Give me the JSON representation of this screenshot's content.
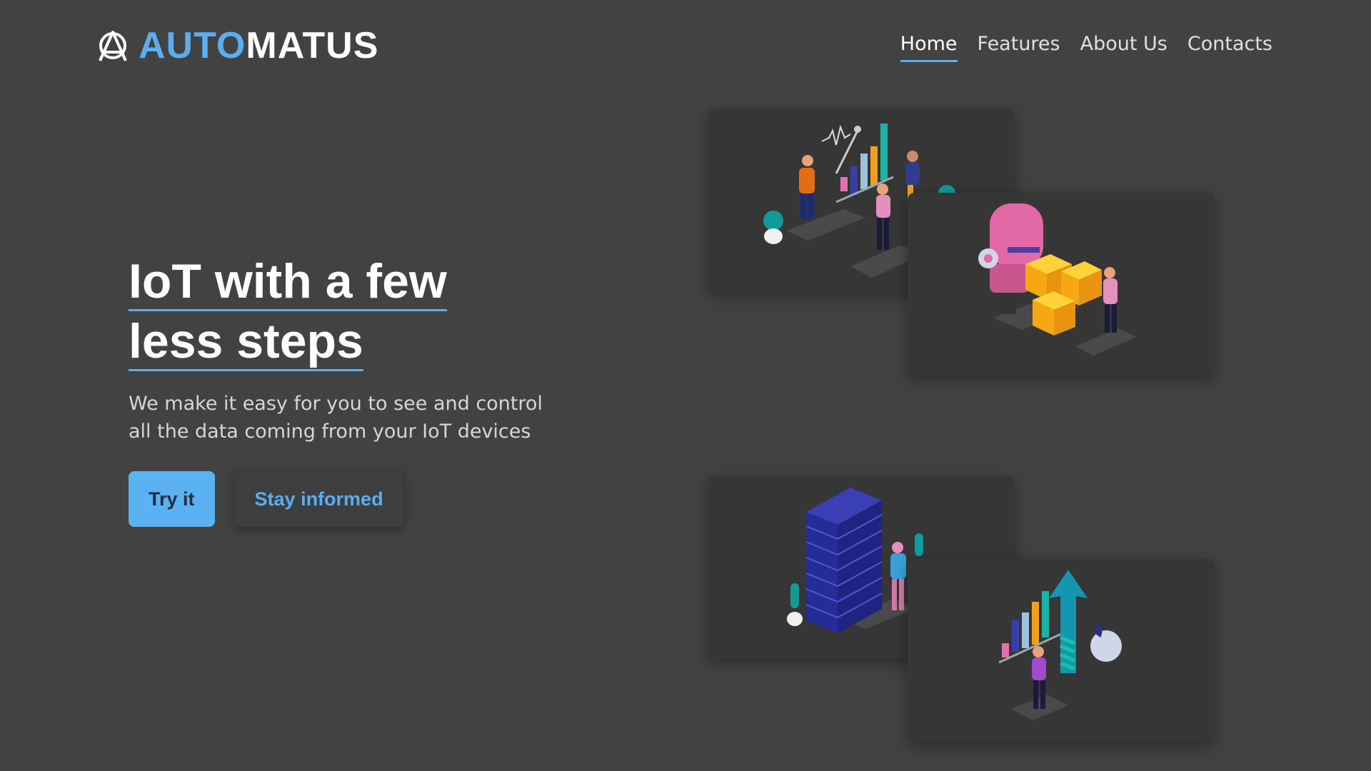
{
  "brand": {
    "name_accent": "AUTO",
    "name_rest": "MATUS",
    "logo_icon": "letter-a-triangle-icon"
  },
  "nav": {
    "items": [
      {
        "label": "Home",
        "active": true
      },
      {
        "label": "Features",
        "active": false
      },
      {
        "label": "About Us",
        "active": false
      },
      {
        "label": "Contacts",
        "active": false
      }
    ]
  },
  "hero": {
    "title_line_1": "IoT with a few",
    "title_line_2": "less steps",
    "subtitle": "We make it easy for you to see and control all the data coming from your IoT devices",
    "primary_button": "Try it",
    "secondary_button": "Stay informed"
  },
  "illustrations": [
    {
      "name": "team-analytics-illustration"
    },
    {
      "name": "robot-boxes-illustration"
    },
    {
      "name": "server-rack-illustration"
    },
    {
      "name": "growth-arrow-illustration"
    }
  ],
  "colors": {
    "background": "#424242",
    "accent": "#5aaeef",
    "card": "#363636"
  }
}
